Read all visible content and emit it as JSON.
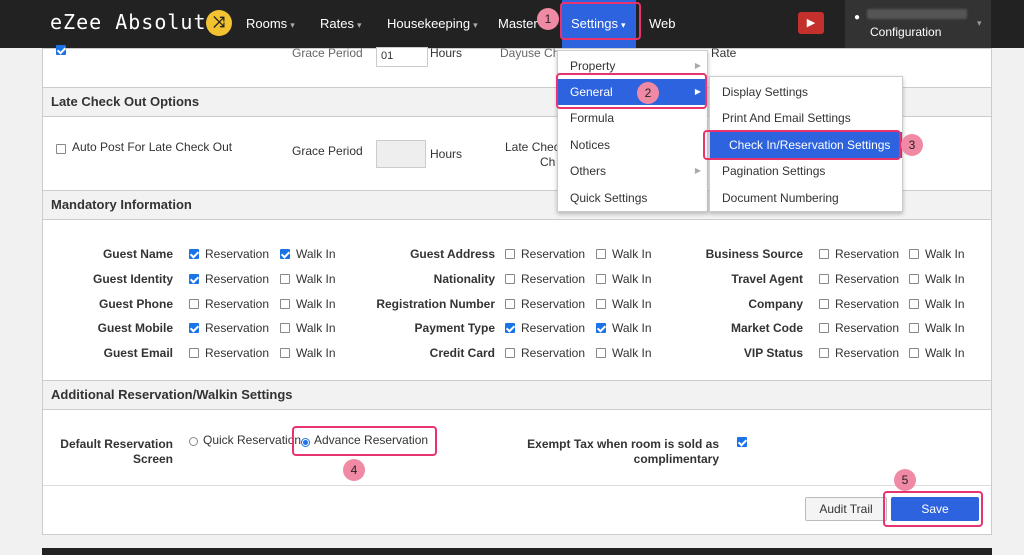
{
  "nav": {
    "logo": "eZee Absolute",
    "logo_badge": "⤨",
    "rooms": "Rooms",
    "rates": "Rates",
    "housekeeping": "Housekeeping",
    "master": "Master",
    "settings": "Settings",
    "web": "Web",
    "youtube_glyph": "▶",
    "user_label": "Configuration"
  },
  "top_partial": {
    "grace_period": "Grace Period",
    "grace_value": "01",
    "hours": "Hours",
    "dayuse": "Dayuse Ch",
    "rate": "Rate"
  },
  "late_checkout": {
    "title": "Late Check Out Options",
    "auto_post": "Auto Post For Late Check Out",
    "grace_period": "Grace Period",
    "hours": "Hours",
    "late_check": "Late Check",
    "ch": "Ch"
  },
  "mandatory": {
    "title": "Mandatory Information",
    "reservation": "Reservation",
    "walkin": "Walk In",
    "col1": [
      {
        "label": "Guest Name",
        "res": true,
        "walk": true
      },
      {
        "label": "Guest Identity",
        "res": true,
        "walk": false
      },
      {
        "label": "Guest Phone",
        "res": false,
        "walk": false
      },
      {
        "label": "Guest Mobile",
        "res": true,
        "walk": false
      },
      {
        "label": "Guest Email",
        "res": false,
        "walk": false
      }
    ],
    "col2": [
      {
        "label": "Guest Address",
        "res": false,
        "walk": false
      },
      {
        "label": "Nationality",
        "res": false,
        "walk": false
      },
      {
        "label": "Registration Number",
        "res": false,
        "walk": false
      },
      {
        "label": "Payment Type",
        "res": true,
        "walk": true
      },
      {
        "label": "Credit Card",
        "res": false,
        "walk": false
      }
    ],
    "col3": [
      {
        "label": "Business Source",
        "res": false,
        "walk": false
      },
      {
        "label": "Travel Agent",
        "res": false,
        "walk": false
      },
      {
        "label": "Company",
        "res": false,
        "walk": false
      },
      {
        "label": "Market Code",
        "res": false,
        "walk": false
      },
      {
        "label": "VIP Status",
        "res": false,
        "walk": false
      }
    ]
  },
  "additional": {
    "title": "Additional Reservation/Walkin Settings",
    "default_label_1": "Default Reservation",
    "default_label_2": "Screen",
    "quick": "Quick Reservation",
    "advance": "Advance Reservation",
    "exempt_1": "Exempt Tax when room is sold as",
    "exempt_2": "complimentary",
    "exempt_checked": true
  },
  "buttons": {
    "audit": "Audit Trail",
    "save": "Save"
  },
  "settings_menu": {
    "items": [
      "Property",
      "General",
      "Formula",
      "Notices",
      "Others",
      "Quick Settings"
    ],
    "arrow": "▶"
  },
  "general_submenu": {
    "items": [
      "Display Settings",
      "Print And Email Settings",
      "Check In/Reservation Settings",
      "Pagination Settings",
      "Document Numbering"
    ]
  },
  "steps": [
    "1",
    "2",
    "3",
    "4",
    "5"
  ],
  "colors": {
    "accent": "#2d63df",
    "highlight": "#e8336e",
    "step_badge": "#f08aa4"
  }
}
